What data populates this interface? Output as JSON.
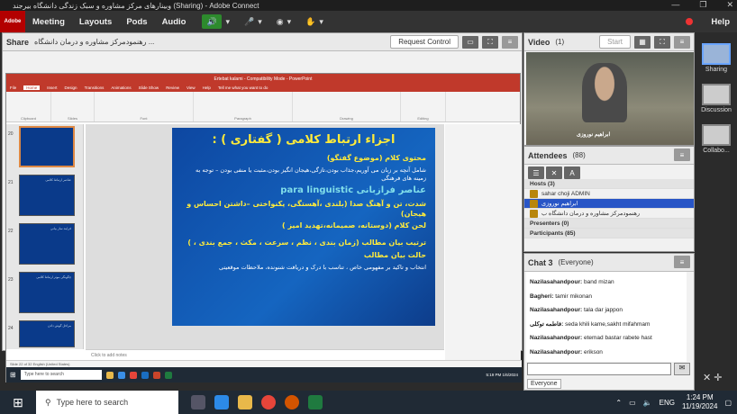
{
  "window": {
    "title": "وبینارهای مرکز مشاوره و سبک زندگی دانشگاه بیرجند (Sharing) - Adobe Connect",
    "controls": [
      "—",
      "❐",
      "✕"
    ]
  },
  "menubar": {
    "logo": "Adobe",
    "items": [
      "Meeting",
      "Layouts",
      "Pods",
      "Audio"
    ],
    "help": "Help"
  },
  "share_pod": {
    "title": "Share",
    "presenter": "رهنمودمرکز مشاوره و درمان دانشگاه ...",
    "request_control": "Request Control"
  },
  "ppt": {
    "window_title": "Ertebat kalami - Compatibility Mode - PowerPoint",
    "tabs": [
      "File",
      "Home",
      "Insert",
      "Design",
      "Transitions",
      "Animations",
      "Slide Show",
      "Review",
      "View",
      "Help",
      "Tell me what you want to do"
    ],
    "ribbon_groups": [
      "Clipboard",
      "Slides",
      "Font",
      "Paragraph",
      "Drawing",
      "Editing"
    ],
    "slide": {
      "title": "اجزاء ارتباط کلامی ( گفتاری ) :",
      "lines": [
        "محتوی کلام (موضوع گفتگو)",
        "شامل آنچه بر زبان می آوریم،جذاب بودن،تازگی،هیجان انگیز بودن،مثبت یا منفی بودن – توجه به زمینه های فرهنگی",
        "عناصر فرازبانی para linguistic",
        "شدت، تن و آهنگ صدا (بلندی ،آهستگی، یکنواختی –داشتن احساس و هیجان)",
        "لحن کلام (دوستانه، صمیمانه،تهدید امیز )",
        "ترتیب بیان مطالب (زمان بندی ، نظم ، سرعت ، مکث ، جمع بندی ، )",
        "حالت بیان مطالب",
        "انتخاب و تاکید بر مفهومی خاص ، تناسب با درک و دریافت شنونده، ملاحظات موقعیتی"
      ]
    },
    "thumb_numbers": [
      "20",
      "21",
      "22",
      "23",
      "24"
    ],
    "thumb_texts": [
      "",
      "عناصر ارتباط کلامی",
      "فرایند ساز بیانی",
      "چگونگی موثر ارتباط کلامی",
      "مراحل گوش دادن"
    ],
    "notes": "Click to add notes",
    "status": "Slide 22 of 32   English (United States)",
    "taskbar_search": "Type here to search",
    "clock": "5:19 PM\n1/6/2024"
  },
  "video_pod": {
    "title": "Video",
    "count": "(1)",
    "start": "Start",
    "name": "ابراهیم نوروزی"
  },
  "attendees": {
    "title": "Attendees",
    "count": "(88)",
    "hosts_label": "Hosts (3)",
    "hosts": [
      "sahar choji ADMIN",
      "ابراهیم نوروزی",
      "رهنمودمرکز مشاوره و درمان دانشگاه ب"
    ],
    "presenters_label": "Presenters (0)",
    "participants_label": "Participants (85)"
  },
  "chat": {
    "title": "Chat 3",
    "scope": "(Everyone)",
    "messages": [
      {
        "from": "Nazilasahandpour:",
        "text": "band mizan"
      },
      {
        "from": "Bagheri:",
        "text": "tamir mikonan"
      },
      {
        "from": "Nazilasahandpour:",
        "text": "tala dar jappon"
      },
      {
        "from": "فاطمه توکلی:",
        "text": "seda khili kame,sakht mifahmam"
      },
      {
        "from": "Nazilasahandpour:",
        "text": "etemad bastar  rabete hast"
      },
      {
        "from": "Nazilasahandpour:",
        "text": "erikson"
      }
    ],
    "recipient": "Everyone"
  },
  "layouts": [
    "Sharing",
    "Discussion",
    "Collabo..."
  ],
  "taskbar": {
    "search": "Type here to search",
    "lang": "ENG",
    "time": "1:24 PM",
    "date": "11/19/2024"
  }
}
